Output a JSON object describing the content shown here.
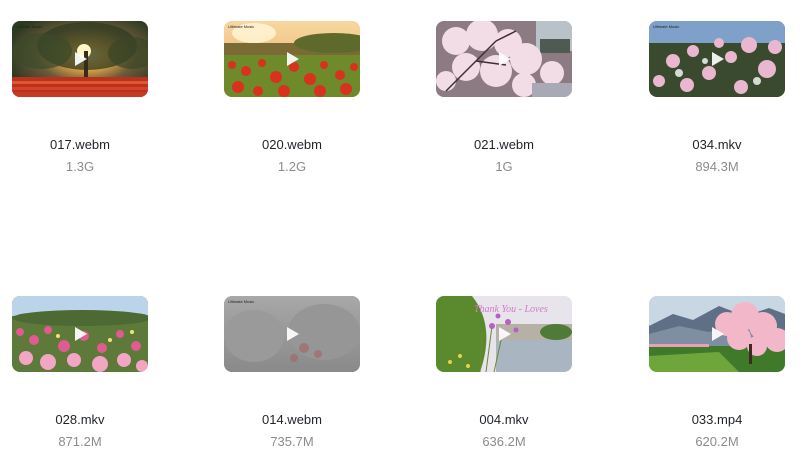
{
  "videos": [
    {
      "name": "017.webm",
      "size": "1.3G",
      "thumb_icon": "video-thumbnail-sunset-tree-flowers"
    },
    {
      "name": "020.webm",
      "size": "1.2G",
      "thumb_icon": "video-thumbnail-red-flower-field"
    },
    {
      "name": "021.webm",
      "size": "1G",
      "thumb_icon": "video-thumbnail-cherry-blossom-tree"
    },
    {
      "name": "034.mkv",
      "size": "894.3M",
      "thumb_icon": "video-thumbnail-pink-roses"
    },
    {
      "name": "028.mkv",
      "size": "871.2M",
      "thumb_icon": "video-thumbnail-rose-garden"
    },
    {
      "name": "014.webm",
      "size": "735.7M",
      "thumb_icon": "video-thumbnail-misty-garden"
    },
    {
      "name": "004.mkv",
      "size": "636.2M",
      "thumb_icon": "video-thumbnail-lake-flowers"
    },
    {
      "name": "033.mp4",
      "size": "620.2M",
      "thumb_icon": "video-thumbnail-mountain-blossom-tree"
    }
  ],
  "thumb_text": {
    "v0": "Ultimate Music",
    "v1": "Ultimate Music",
    "v3": "Ultimate Music",
    "v5": "Ultimate Music",
    "v6": "Thank You - Loves"
  }
}
